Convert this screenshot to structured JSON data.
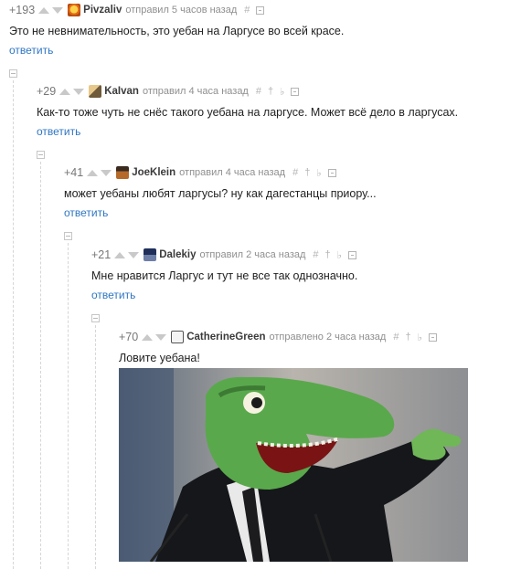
{
  "comments": [
    {
      "rating": "+193",
      "nick": "Pivzaliv",
      "meta": "отправил 5 часов назад",
      "tools": [
        "#"
      ],
      "text": "Это не невнимательность, это уебан на Ларгусе во всей красе.",
      "reply": "ответить"
    },
    {
      "rating": "+29",
      "nick": "KaIvan",
      "meta": "отправил 4 часа назад",
      "tools": [
        "#",
        "†",
        "♭"
      ],
      "text": "Как-то тоже чуть не снёс такого уебана на ларгусе. Может всё дело в ларгусах.",
      "reply": "ответить"
    },
    {
      "rating": "+41",
      "nick": "JoeKlein",
      "meta": "отправил 4 часа назад",
      "tools": [
        "#",
        "†",
        "♭"
      ],
      "text": "может уебаны любят ларгусы? ну как дагестанцы приору...",
      "reply": "ответить"
    },
    {
      "rating": "+21",
      "nick": "Dalekiy",
      "meta": "отправил 2 часа назад",
      "tools": [
        "#",
        "†",
        "♭"
      ],
      "text": "Мне нравится Ларгус и тут не все так однозначно.",
      "reply": "ответить"
    },
    {
      "rating": "+70",
      "nick": "CatherineGreen",
      "meta": "отправлено 2 часа назад",
      "tools": [
        "#",
        "†",
        "♭"
      ],
      "text": "Ловите уебана!"
    }
  ],
  "colors": {
    "link": "#2f76c3",
    "nick": "#3b3b3b",
    "meta": "#8f8f8f"
  }
}
